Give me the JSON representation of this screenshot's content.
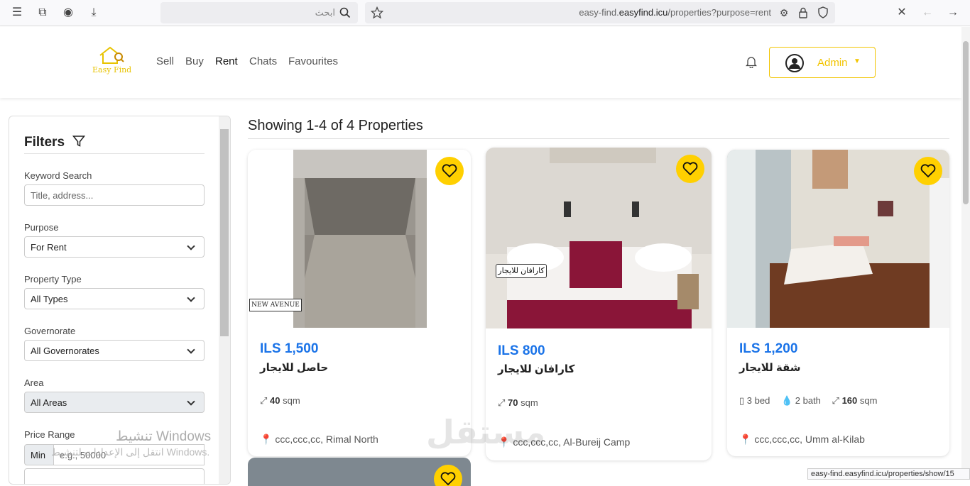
{
  "browser": {
    "search_placeholder": "ابحث",
    "url_host": "easy-find.",
    "url_domain": "easyfind.icu",
    "url_path": "/properties?purpose=rent",
    "status_url": "easy-find.easyfind.icu/properties/show/15"
  },
  "nav": {
    "logo_text": "Easy Find",
    "links": [
      "Sell",
      "Buy",
      "Rent",
      "Chats",
      "Favourites"
    ],
    "active": "Rent",
    "user": "Admin"
  },
  "filters": {
    "title": "Filters",
    "keyword_label": "Keyword Search",
    "keyword_placeholder": "Title, address...",
    "purpose_label": "Purpose",
    "purpose_value": "For Rent",
    "type_label": "Property Type",
    "type_value": "All Types",
    "gov_label": "Governorate",
    "gov_value": "All Governorates",
    "area_label": "Area",
    "area_value": "All Areas",
    "price_label": "Price Range",
    "min_label": "Min",
    "min_placeholder": "e.g., 50000"
  },
  "results": {
    "heading": "Showing 1-4 of 4 Properties"
  },
  "properties": [
    {
      "price": "ILS 1,500",
      "title": "حاصل للايجار",
      "sqm": "40",
      "sqm_unit": "sqm",
      "location": "ccc,ccc,cc, Rimal North",
      "watermark": "NEW AVENUE"
    },
    {
      "price": "ILS 800",
      "title": "كارافان للايجار",
      "sqm": "70",
      "sqm_unit": "sqm",
      "location": "ccc,ccc,cc, Al-Bureij Camp",
      "image_label": "كارافان للايجار"
    },
    {
      "price": "ILS 1,200",
      "title": "شقة للايجار",
      "beds": "3 bed",
      "baths": "2 bath",
      "sqm": "160",
      "sqm_unit": "sqm",
      "location": "ccc,ccc,cc, Umm al-Kilab"
    }
  ],
  "overlay": {
    "windows_title": "تنشيط Windows",
    "windows_sub": "انتقل إلى الإعدادات لتنشيط Windows.",
    "brand": "مستقل"
  },
  "colors": {
    "accent": "#ffd000",
    "price": "#1a73e8"
  }
}
